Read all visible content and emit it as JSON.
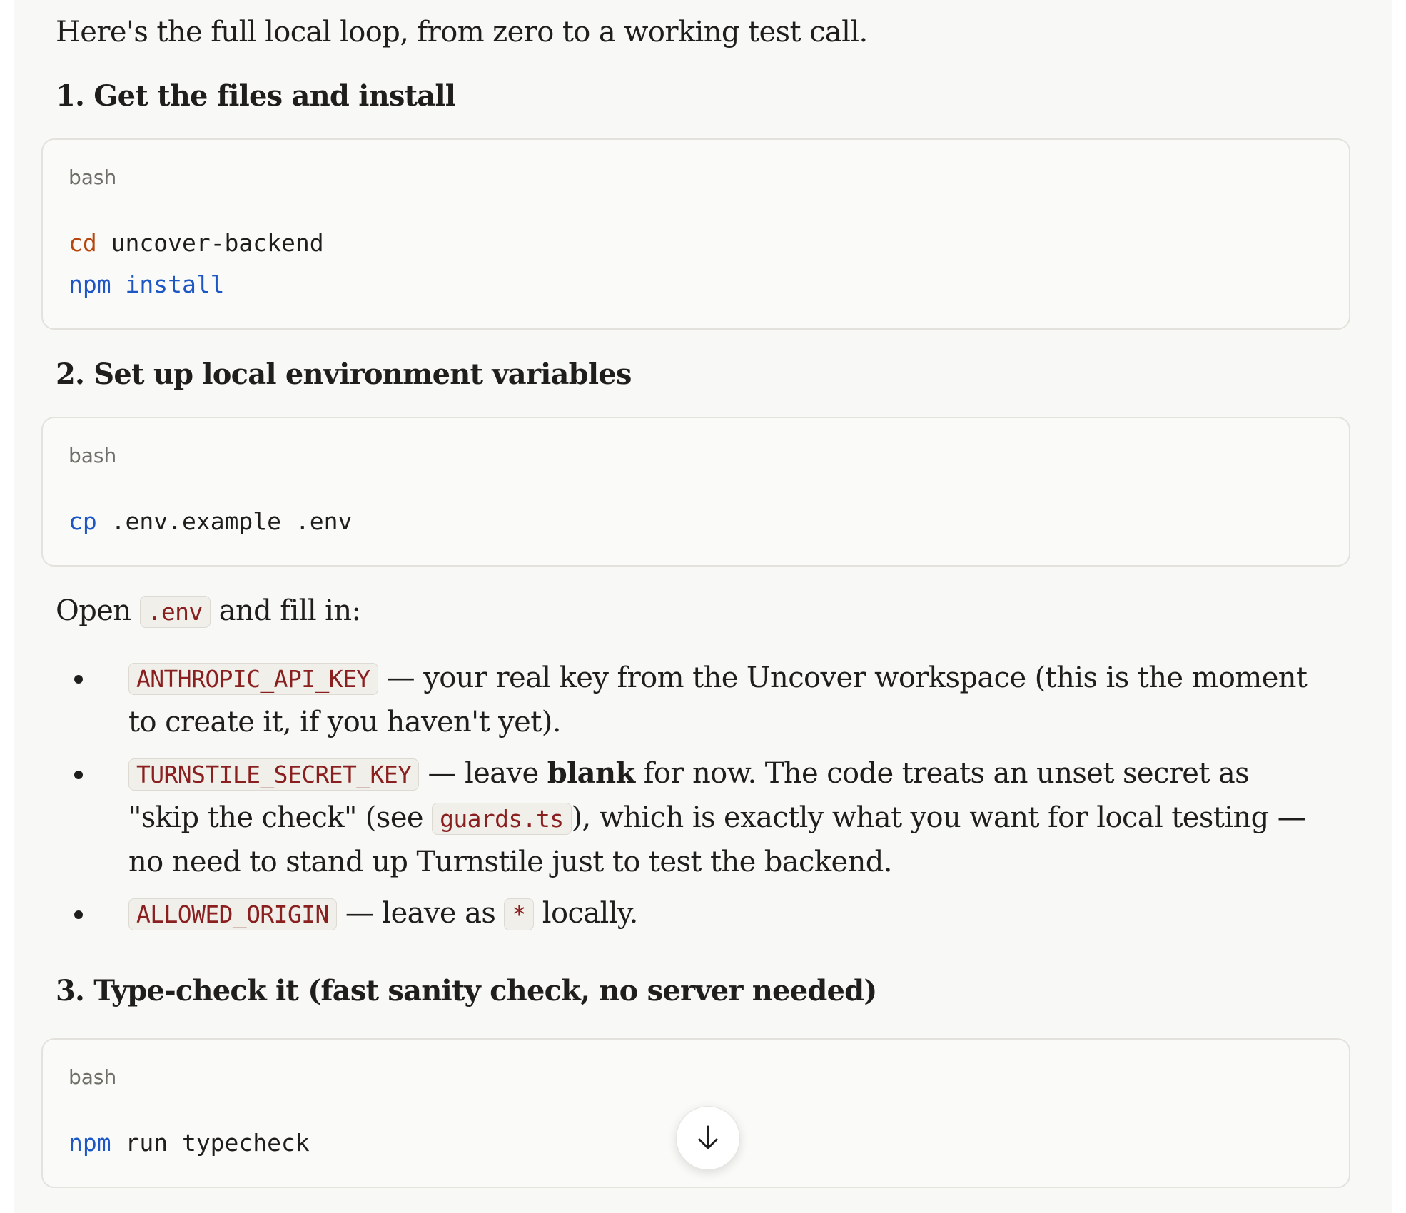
{
  "intro": "Here's the full local loop, from zero to a working test call.",
  "sections": [
    {
      "heading": "1. Get the files and install",
      "code_lang": "bash",
      "lines": [
        [
          {
            "t": "cd",
            "k": "builtin"
          },
          {
            "t": " uncover-backend",
            "k": "arg"
          }
        ],
        [
          {
            "t": "npm",
            "k": "cmd"
          },
          {
            "t": " install",
            "k": "cmd-arg"
          }
        ]
      ]
    },
    {
      "heading": "2. Set up local environment variables",
      "code_lang": "bash",
      "lines": [
        [
          {
            "t": "cp",
            "k": "cmd"
          },
          {
            "t": " .env.example .env",
            "k": "arg"
          }
        ]
      ]
    },
    {
      "heading": "3. Type-check it (fast sanity check, no server needed)",
      "code_lang": "bash",
      "lines": [
        [
          {
            "t": "npm",
            "k": "cmd"
          },
          {
            "t": " run typecheck",
            "k": "arg"
          }
        ]
      ]
    }
  ],
  "open_env": {
    "before": "Open ",
    "code": ".env",
    "after": " and fill in:"
  },
  "bullets": {
    "b1": {
      "code": "ANTHROPIC_API_KEY",
      "line1": " — your real key from the Uncover workspace (this is the moment",
      "line2": "to create it, if you haven't yet)."
    },
    "b2": {
      "code": "TURNSTILE_SECRET_KEY",
      "pre_bold": " — leave ",
      "bold": "blank",
      "post_bold": " for now. The code treats an unset secret as",
      "line2_before": "\"skip the check\" (see ",
      "line2_code": "guards.ts",
      "line2_after": "), which is exactly what you want for local testing —",
      "line3": "no need to stand up Turnstile just to test the backend."
    },
    "b3": {
      "code": "ALLOWED_ORIGIN",
      "mid": " — leave as ",
      "code2": "*",
      "after": " locally."
    }
  },
  "scroll_button_icon": "arrow-down-icon"
}
